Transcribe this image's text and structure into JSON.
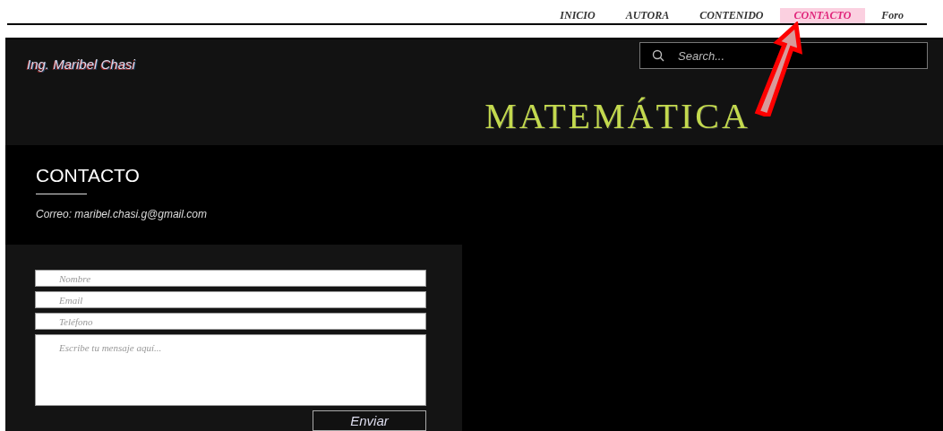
{
  "nav": {
    "items": [
      {
        "label": "INICIO",
        "selected": false
      },
      {
        "label": "AUTORA",
        "selected": false
      },
      {
        "label": "CONTENIDO",
        "selected": false
      },
      {
        "label": "CONTACTO",
        "selected": true
      },
      {
        "label": "Foro",
        "selected": false
      }
    ]
  },
  "header": {
    "author": "Ing. Maribel Chasi",
    "search": {
      "placeholder": "Search..."
    },
    "title": "MATEMÁTICA"
  },
  "contact": {
    "heading": "CONTACTO",
    "email": "Correo: maribel.chasi.g@gmail.com"
  },
  "form": {
    "fields": [
      {
        "kind": "input",
        "placeholder": "Nombre"
      },
      {
        "kind": "input",
        "placeholder": "Email"
      },
      {
        "kind": "input",
        "placeholder": "Teléfono"
      },
      {
        "kind": "textarea",
        "placeholder": "Escribe tu mensaje aquí..."
      }
    ],
    "submit": "Enviar"
  }
}
